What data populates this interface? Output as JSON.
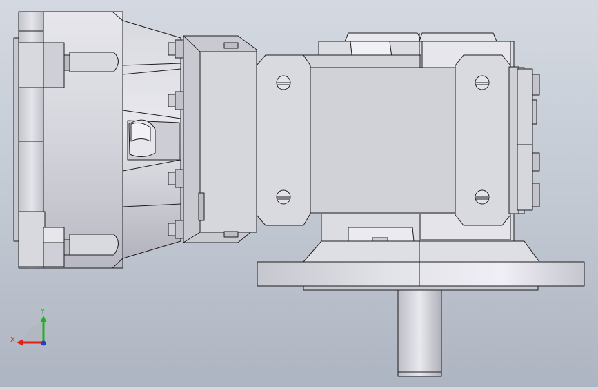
{
  "viewport": {
    "background_top": "#d4d9e1",
    "background_bottom": "#aeb5c2",
    "model_face_color": "#d4d4dc",
    "model_edge_color": "#1e1e1e"
  },
  "triad": {
    "x_label": "X",
    "y_label": "Y",
    "x_color": "#e0201c",
    "y_color": "#22b022",
    "z_color": "#1f3fd0"
  }
}
